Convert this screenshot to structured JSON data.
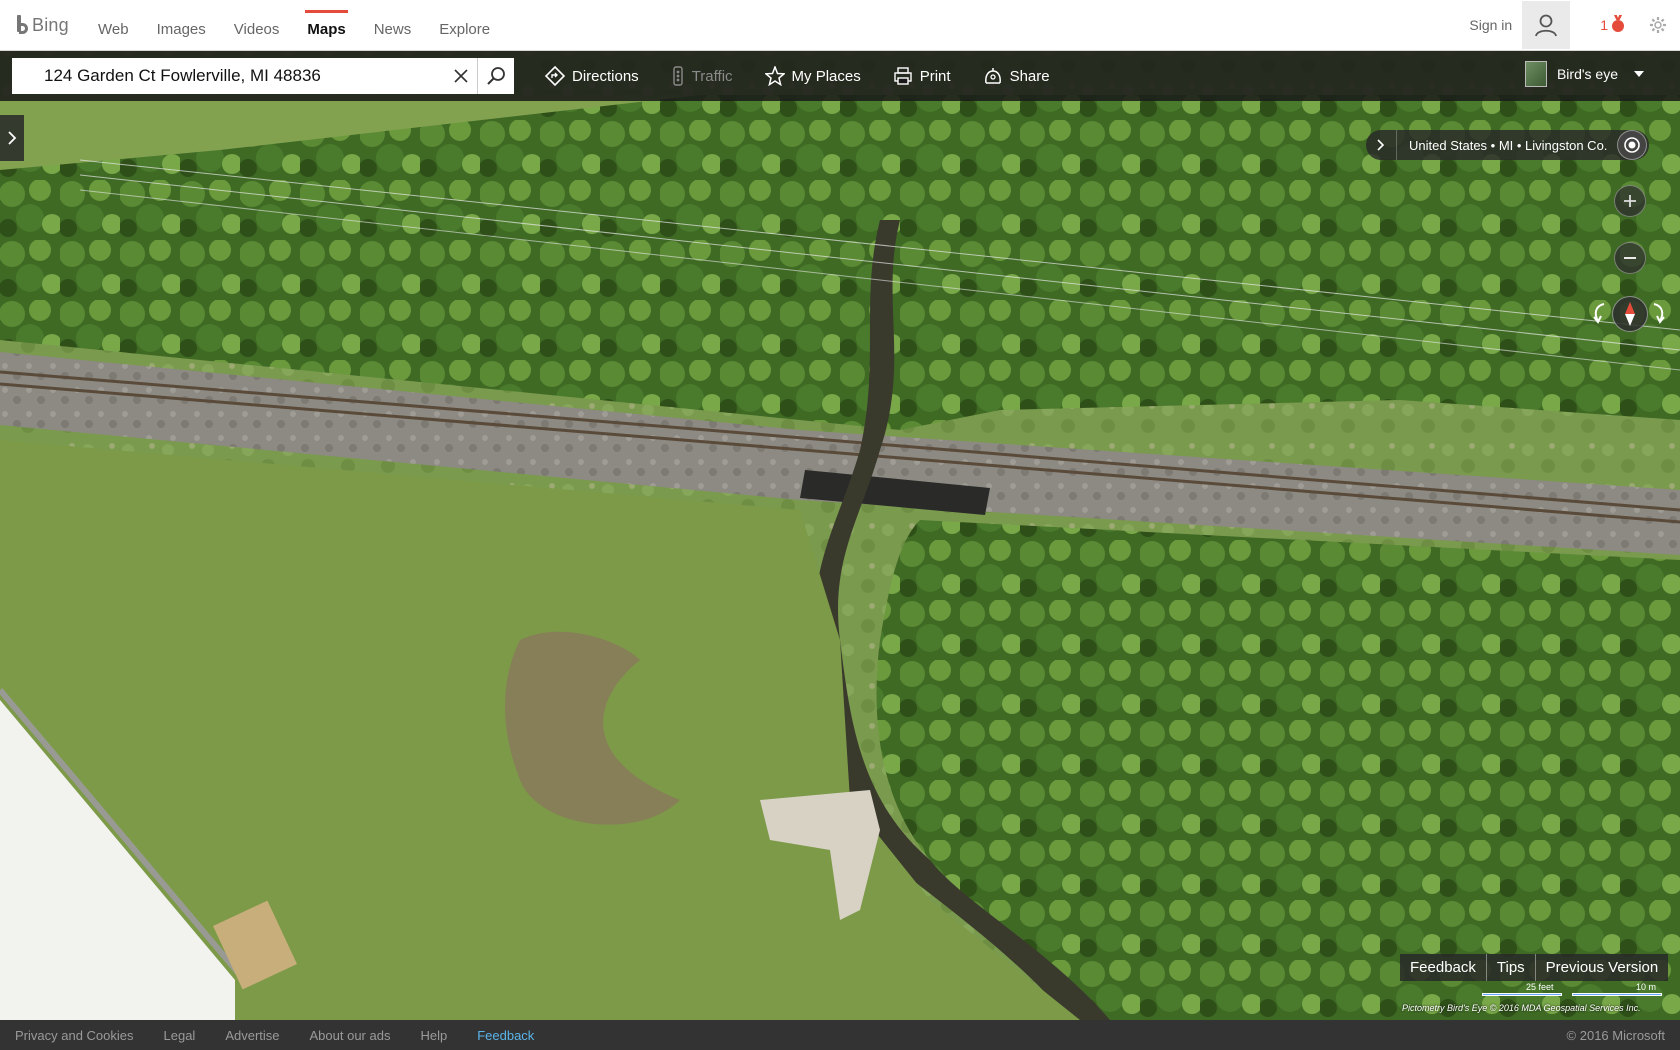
{
  "brand": {
    "name": "Bing"
  },
  "nav": {
    "items": [
      {
        "label": "Web"
      },
      {
        "label": "Images"
      },
      {
        "label": "Videos"
      },
      {
        "label": "Maps",
        "active": true
      },
      {
        "label": "News"
      },
      {
        "label": "Explore"
      }
    ]
  },
  "account": {
    "signin_label": "Sign in",
    "rewards_count": "1"
  },
  "search": {
    "value": "124 Garden Ct Fowlerville, MI 48836",
    "placeholder": ""
  },
  "toolbar": {
    "directions_label": "Directions",
    "traffic_label": "Traffic",
    "myplaces_label": "My Places",
    "print_label": "Print",
    "share_label": "Share",
    "view_label": "Bird's eye"
  },
  "breadcrumb": {
    "text": "United States • MI • Livingston Co."
  },
  "map_feedback": {
    "feedback_label": "Feedback",
    "tips_label": "Tips",
    "previous_label": "Previous Version"
  },
  "scale": {
    "feet_label": "25 feet",
    "meters_label": "10 m"
  },
  "attribution": "Pictometry Bird's Eye © 2016 MDA Geospatial Services Inc.",
  "footer": {
    "links": [
      "Privacy and Cookies",
      "Legal",
      "Advertise",
      "About our ads",
      "Help"
    ],
    "feedback_label": "Feedback",
    "copyright": "© 2016 Microsoft"
  },
  "colors": {
    "accent_red": "#e44b3a",
    "feedback_blue": "#5ab4e8",
    "toolbar_bg": "#181818",
    "scale_blue": "#62a8ff"
  },
  "icons": [
    "bing-logo",
    "user-icon",
    "medal-icon",
    "gear-icon",
    "close-icon",
    "search-icon",
    "directions-icon",
    "traffic-icon",
    "star-icon",
    "printer-icon",
    "share-icon",
    "chevron-right-icon",
    "locate-icon",
    "zoom-in-icon",
    "zoom-out-icon",
    "compass-icon",
    "rotate-left-icon",
    "rotate-right-icon"
  ]
}
